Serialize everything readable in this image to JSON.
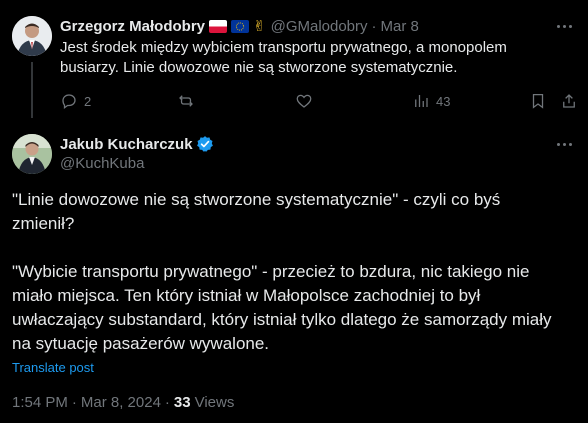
{
  "reply_tweet": {
    "author_name": "Grzegorz Małodobry",
    "author_emoji": "✌",
    "handle": "@GMalodobry",
    "separator": "·",
    "date": "Mar 8",
    "text_line1": "Jest środek między wybiciem transportu prywatnego, a monopolem",
    "text_line2": "busiarzy. Linie dowozowe nie są stworzone systematycznie.",
    "reply_count": "2",
    "views_count": "43"
  },
  "main_tweet": {
    "author_name": "Jakub Kucharczuk",
    "handle": "@KuchKuba",
    "paragraph1_line1": "\"Linie dowozowe nie są stworzone systematycznie\" - czyli co byś",
    "paragraph1_line2": "zmienił?",
    "paragraph2_line1": "\"Wybicie transportu prywatnego\" - przecież to bzdura, nic takiego nie",
    "paragraph2_line2": "miało miejsca. Ten który istniał w Małopolsce zachodniej to był",
    "paragraph2_line3": "uwłaczający substandard, który istniał tylko dlatego że samorządy miały",
    "paragraph2_line4": "na sytuację pasażerów wywalone.",
    "translate_label": "Translate post",
    "time": "1:54 PM",
    "separator": "·",
    "date": "Mar 8, 2024",
    "views_count": "33",
    "views_label": "Views"
  },
  "colors": {
    "background": "#000000",
    "text": "#e7e9ea",
    "muted": "#71767b",
    "link": "#1d9bf0",
    "verified": "#1d9bf0"
  }
}
